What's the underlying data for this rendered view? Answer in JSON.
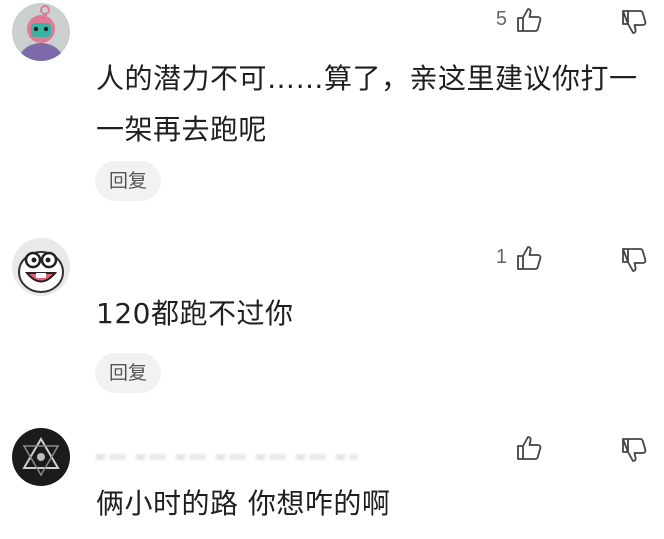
{
  "comments": [
    {
      "likes": "5",
      "text_line1": "人的潜力不可……算了，亲这里建议你打一",
      "text_line2": "一架再去跑呢",
      "reply_label": "回复",
      "avatar_icon": "avatar-pink-character-icon"
    },
    {
      "likes": "1",
      "text_line1": "120都跑不过你",
      "reply_label": "回复",
      "avatar_icon": "avatar-cartoon-face-icon"
    },
    {
      "likes": "",
      "text_line1": "俩小时的路 你想咋的啊",
      "avatar_icon": "avatar-geometric-logo-icon"
    }
  ],
  "icons": {
    "like": "thumbs-up-icon",
    "dislike": "thumbs-down-icon"
  },
  "colors": {
    "text": "#1f1f1f",
    "muted": "#666666",
    "reply_bg": "#f2f2f2"
  }
}
